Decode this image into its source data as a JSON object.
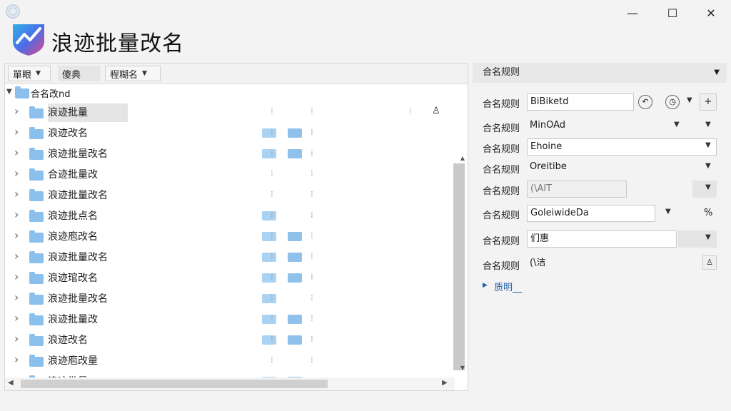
{
  "window": {
    "title": "浪迹批量改名",
    "controls": {
      "minimize": "—",
      "maximize": "☐",
      "close": "✕"
    }
  },
  "toolbar": {
    "buttons": [
      "單眼",
      "傻典",
      "程糊名"
    ]
  },
  "tree": {
    "root_label": "合名改nd",
    "items": [
      "浪迹批量",
      "浪迹改名",
      "浪迹批量改名",
      "合迹批量改",
      "浪迹批量改名",
      "浪迹批点名",
      "浪迹庖改名",
      "浪迹批量改名",
      "浪迹琯改名",
      "浪迹批量改名",
      "浪迹批量改",
      "浪迹改名",
      "浪迹庖改量",
      "浪迹批量"
    ]
  },
  "properties": {
    "header": "合名规则",
    "rows": [
      {
        "label": "合名规则",
        "value": "BiBiketd"
      },
      {
        "label": "合名规则",
        "value": "MinOAd"
      },
      {
        "label": "合名规则",
        "value": "Ehoine"
      },
      {
        "label": "合名规则",
        "value": "Oreitibe"
      },
      {
        "label": "合名规则",
        "value": "(\\AIT"
      },
      {
        "label": "合名规则",
        "value": "GoleiwideDa",
        "suffix": "%"
      },
      {
        "label": "合名规则",
        "value": "们惠"
      },
      {
        "label": "合名规则",
        "value": "(\\洁"
      }
    ],
    "more_link": "质明__"
  },
  "colors": {
    "folder": "#8cc0ec",
    "link": "#1f5fa8"
  }
}
